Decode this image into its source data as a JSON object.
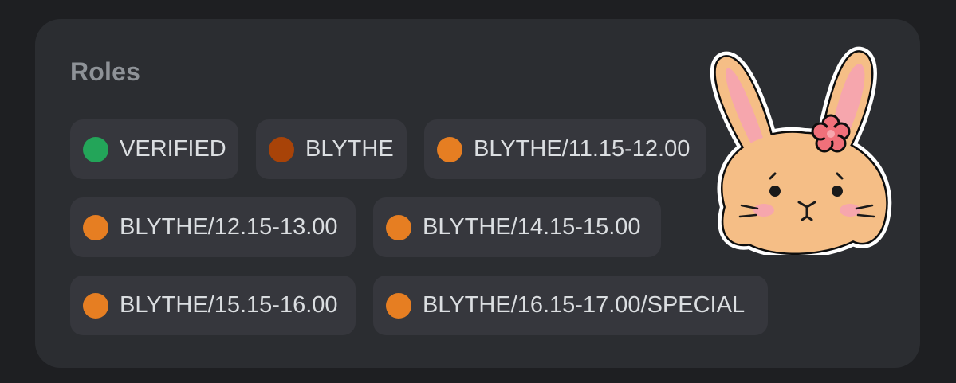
{
  "roles_section": {
    "title": "Roles",
    "roles": [
      {
        "label": "VERIFIED",
        "color": "#23a559"
      },
      {
        "label": "BLYTHE",
        "color": "#a84308"
      },
      {
        "label": "BLYTHE/11.15-12.00",
        "color": "#e67e22"
      },
      {
        "label": "BLYTHE/12.15-13.00",
        "color": "#e67e22"
      },
      {
        "label": "BLYTHE/14.15-15.00",
        "color": "#e67e22"
      },
      {
        "label": "BLYTHE/15.15-16.00",
        "color": "#e67e22"
      },
      {
        "label": "BLYTHE/16.15-17.00/SPECIAL",
        "color": "#e67e22"
      }
    ]
  },
  "sticker": {
    "icon": "bunny-sticker-icon"
  }
}
